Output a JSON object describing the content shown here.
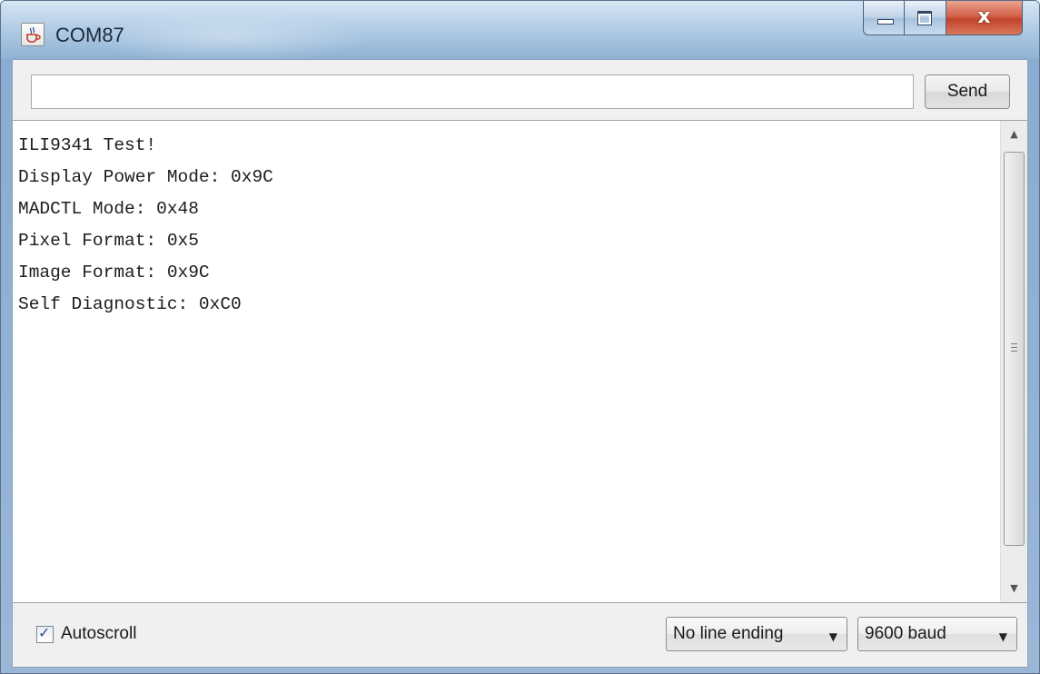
{
  "window": {
    "title": "COM87",
    "app_icon": "java-cup-icon",
    "controls": [
      "minimize-icon",
      "maximize-icon",
      "close-icon"
    ],
    "close_glyph": "x"
  },
  "send_bar": {
    "input_value": "",
    "input_placeholder": "",
    "send_label": "Send"
  },
  "output": {
    "lines": [
      "ILI9341 Test!",
      "Display Power Mode: 0x9C",
      "MADCTL Mode: 0x48",
      "Pixel Format: 0x5",
      "Image Format: 0x9C",
      "Self Diagnostic: 0xC0"
    ]
  },
  "status_bar": {
    "autoscroll_label": "Autoscroll",
    "autoscroll_checked": true,
    "line_ending": "No line ending",
    "baud_rate": "9600 baud"
  },
  "colors": {
    "title_bar": "#a9c6e3",
    "close_button": "#c94a31",
    "client_bg": "#f0f0f0",
    "output_bg": "#ffffff"
  }
}
